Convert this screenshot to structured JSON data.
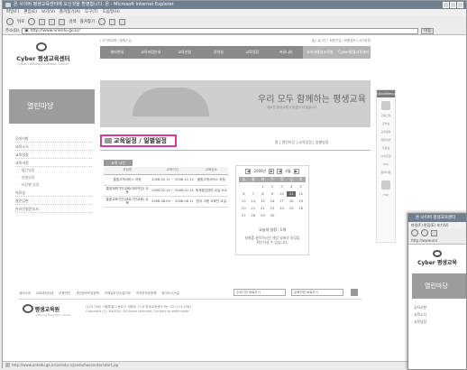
{
  "browser": {
    "title": "온 사이버 평생교육센터에 오신것을 환영합니다. 온 - Microsoft Internet Explorer",
    "menu": [
      "파일(F)",
      "편집(E)",
      "보기(V)",
      "즐겨찾기(A)",
      "도구(T)",
      "도움말(H)"
    ],
    "toolbar": [
      "뒤로",
      "검색",
      "즐겨찾기"
    ],
    "address_label": "주소(D)",
    "url": "http://www.onledu.go.kr/",
    "go_label": "이동",
    "status_url": "http://www.onledu.go.kr/onledu-n/jsedu/twocenter/start.jsp"
  },
  "site": {
    "logo_name": "Cyber 평생교육센터",
    "logo_sub": "Cyber Lifelong Education Center",
    "top_links": [
      "| 사이버교육 | 회원가입",
      "홈 | 로그인 | 회원가입 | 회원정보 | 사이트맵"
    ],
    "gnb": [
      "센터안내",
      "교육과정안내",
      "교육신청",
      "강의실",
      "교육일정",
      "커뮤니티",
      "사이버평생교육원",
      "Cyber평생교육센터"
    ]
  },
  "lnb": {
    "header": "열린마당",
    "items": [
      "공지사항",
      "교육소식",
      "교육일정",
      "교육과정"
    ],
    "subitems": [
      "- 월간일정",
      "- 일별일정",
      "- 과정별 일정"
    ],
    "items_after": [
      "자료실",
      "질문답변",
      "온라인설문조사"
    ]
  },
  "banner": {
    "slogan": "우리 모두 함께하는 평생교육",
    "slogan_sub": "새로운 평생교육의 중심이 되겠습니다"
  },
  "content": {
    "title": "교육일정 / 일별일정",
    "breadcrumb": "홈 | 열린마당 | 교육일정 | 일별일정",
    "subtab": "교육 시간",
    "table_headers": [
      "과정명",
      "교육기간",
      "교육장소"
    ],
    "rows": [
      {
        "name": "통합고객서비스 과정",
        "period": "2008.02.11 ~ 2008.12.12",
        "place": "통합고객서비스 과정"
      },
      {
        "name": "통합계획기관교육(대외직업) 교육",
        "period": "2008.02.14 ~ 2008.02.14",
        "place": "세계창업센터 교실 소수"
      },
      {
        "name": "통합교육기관(대외기관교육) 교육",
        "period": "2008.06.09 ~ 2008.06.11",
        "place": "한국 고용 교육관 교실"
      }
    ]
  },
  "calendar": {
    "year_label": "2008년",
    "month_label": "4월",
    "prev": "◀",
    "next": "▶",
    "dow": [
      "일",
      "월",
      "화",
      "수",
      "목",
      "금",
      "토"
    ],
    "days": [
      "",
      "",
      "1",
      "2",
      "3",
      "4",
      "5",
      "6",
      "7",
      "8",
      "9",
      "10",
      "11",
      "12",
      "13",
      "14",
      "15",
      "16",
      "17",
      "18",
      "19",
      "20",
      "21",
      "22",
      "23",
      "24",
      "25",
      "26",
      "27",
      "28",
      "29",
      "30",
      "",
      "",
      ""
    ],
    "highlight_day": "11",
    "note_title": "오늘의 일정 : 1개",
    "note_lines": [
      "날짜를 클릭하시면 해당 날짜의 일정을",
      "확인하실 수 있습니다."
    ]
  },
  "quick": {
    "header": "QuickMenu",
    "items": [
      "교육신청",
      "강의실",
      "교육일정",
      "질문답변",
      "자료실",
      "사이트맵",
      "FAQ",
      "원격지원",
      "TOP"
    ]
  },
  "footer": {
    "links": [
      "센터소개",
      "교육과정안내",
      "이용약관",
      "개인정보보호정책",
      "이메일무단수집거부",
      "저작권보호정책",
      "찾아오시는길"
    ],
    "select1": "주요기관 바로가기",
    "select2": "교육관련 바로가기",
    "logo_name": "평생교육원",
    "logo_sub": "Lifelong Education Center",
    "address": [
      "(110-760) 서울특별시 종로구 세종로 77-6 평생교육센터 Tel: 02) 123-4567",
      "Copyright (C) ONLEDU. All rights reserved. Contact to webmaster."
    ]
  },
  "second_window": {
    "title": "온 사이버 평생교육센터",
    "menu": "파일(F) 편집(E) 보기(V)",
    "address": "http://www.onl",
    "logo_name": "Cyber 평생교육",
    "header": "열린마당",
    "items": [
      "공지사항",
      "교육소식",
      "교육일정"
    ]
  }
}
